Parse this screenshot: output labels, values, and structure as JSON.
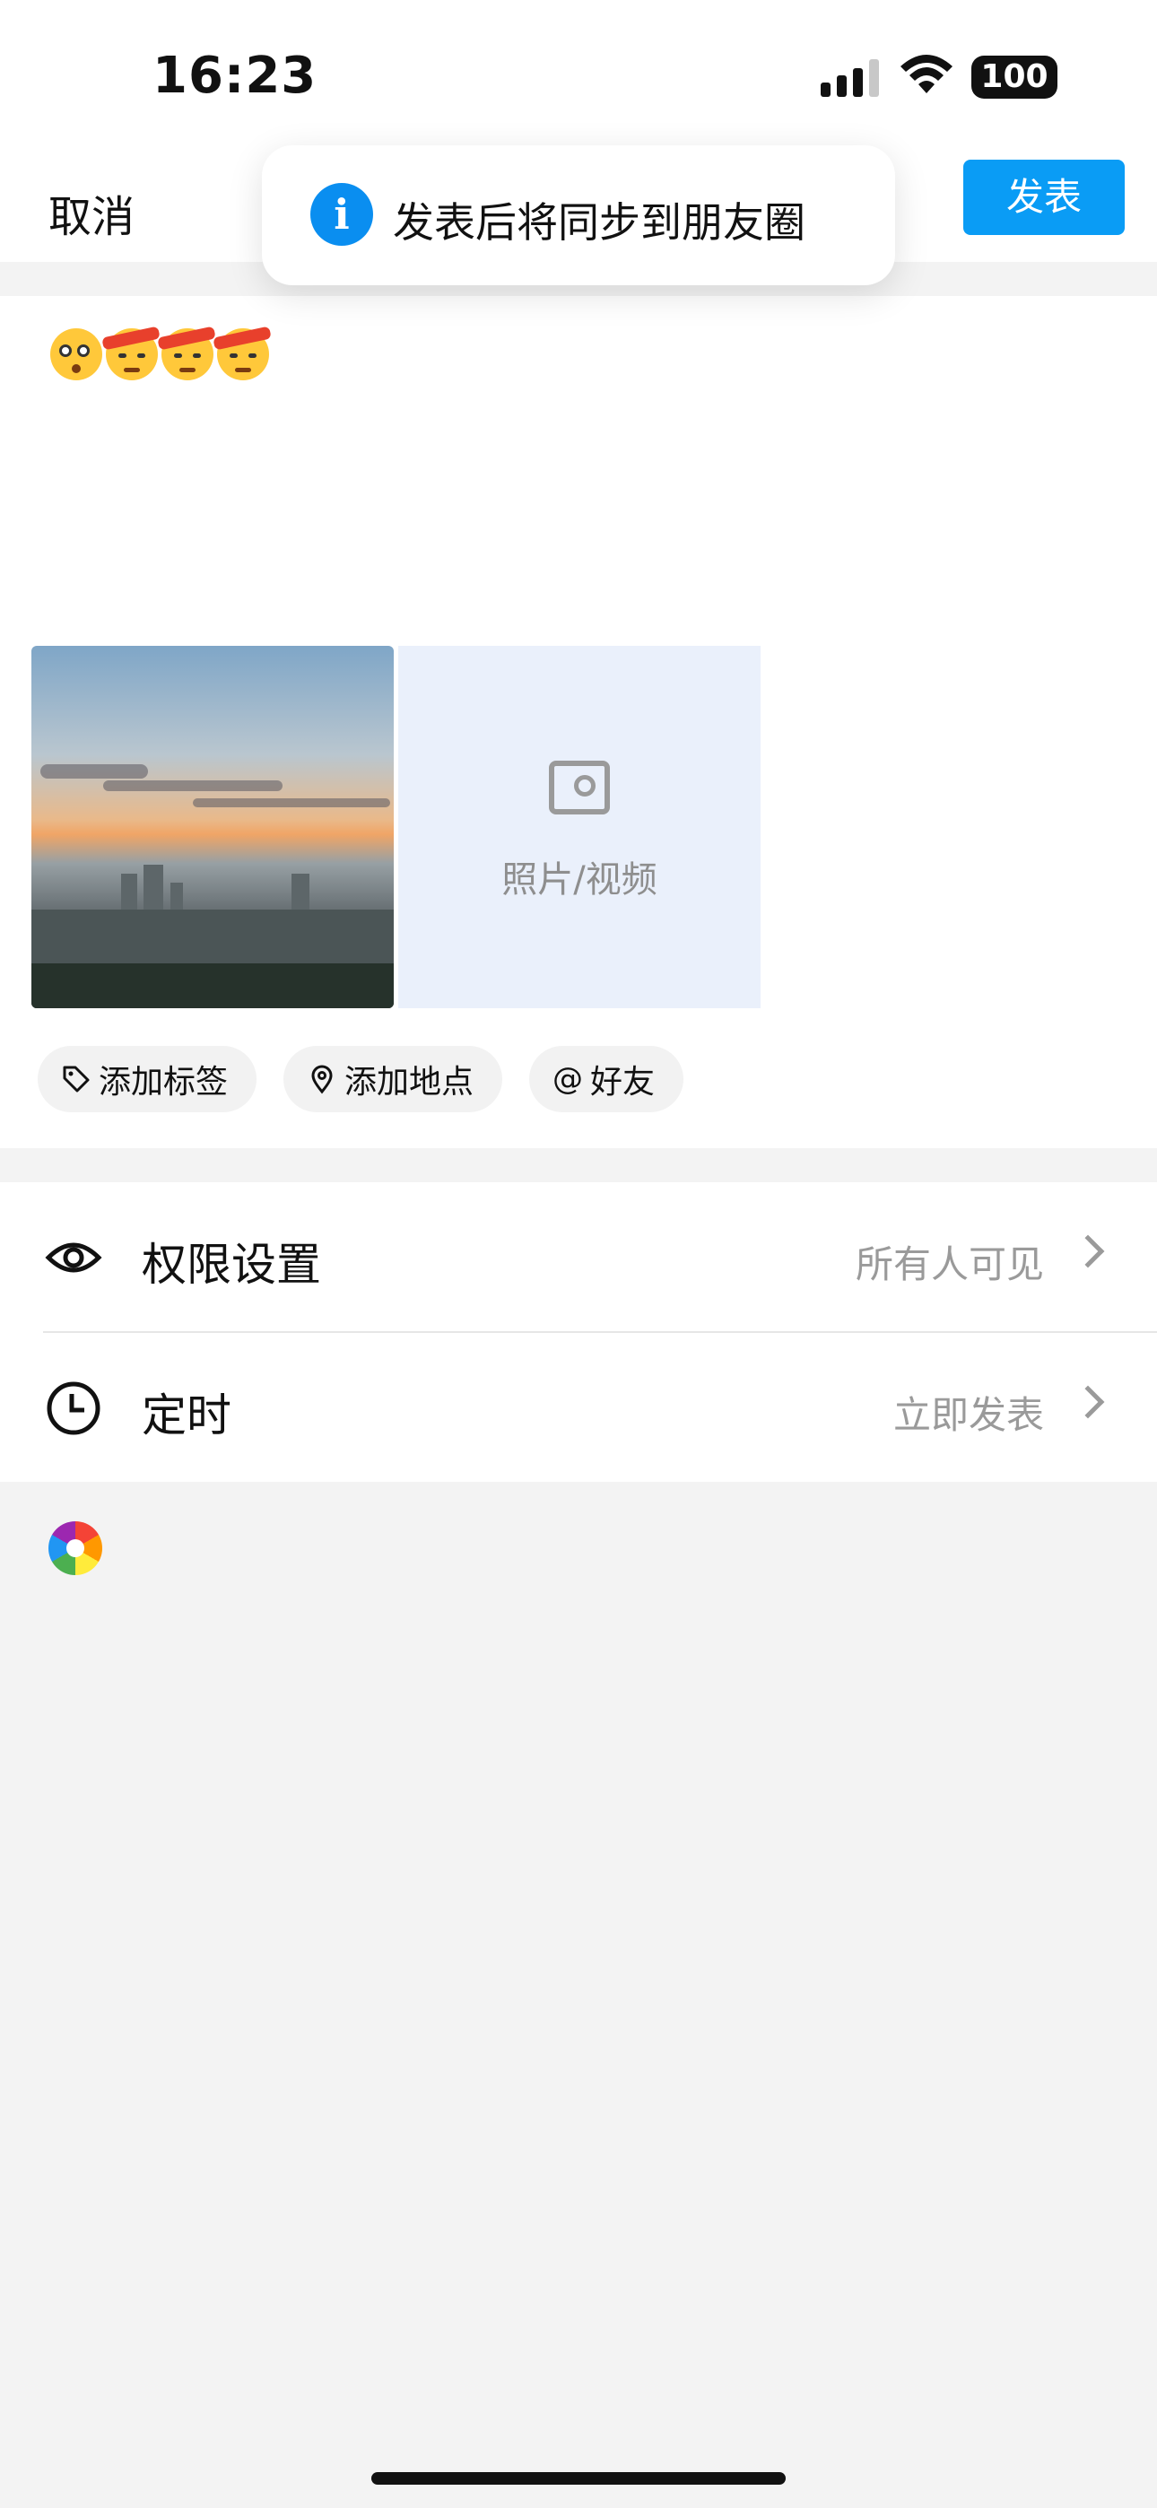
{
  "status_bar": {
    "time": "16:23",
    "battery": "100"
  },
  "nav": {
    "cancel_label": "取消",
    "publish_label": "发表"
  },
  "toast": {
    "icon": "i",
    "text": "发表后将同步到朋友圈"
  },
  "post": {
    "emojis": [
      "flushed-face",
      "angry-headband-face",
      "angry-headband-face",
      "angry-headband-face"
    ],
    "add_media_label": "照片/视频"
  },
  "chips": [
    {
      "icon": "tag-icon",
      "label": "添加标签"
    },
    {
      "icon": "location-pin-icon",
      "label": "添加地点"
    },
    {
      "icon": "at-icon",
      "label": "好友"
    }
  ],
  "settings": [
    {
      "icon": "eye-icon",
      "label": "权限设置",
      "value": "所有人可见"
    },
    {
      "icon": "clock-icon",
      "label": "定时",
      "value": "立即发表"
    }
  ],
  "colors": {
    "accent": "#0a9cf5",
    "page_bg": "#f3f3f3",
    "media_placeholder_bg": "#eaf0fb"
  }
}
